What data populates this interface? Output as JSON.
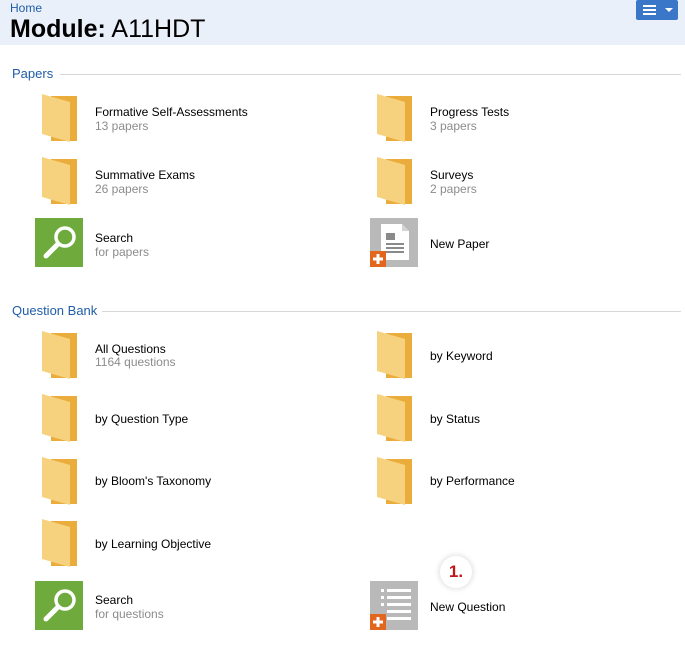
{
  "header": {
    "breadcrumb": "Home",
    "title_prefix": "Module:",
    "title_code": "A11HDT"
  },
  "papers": {
    "title": "Papers",
    "formative": {
      "label": "Formative Self-Assessments",
      "sub": "13 papers"
    },
    "progress": {
      "label": "Progress Tests",
      "sub": "3 papers"
    },
    "summative": {
      "label": "Summative Exams",
      "sub": "26 papers"
    },
    "surveys": {
      "label": "Surveys",
      "sub": "2 papers"
    },
    "search": {
      "label": "Search",
      "sub": "for papers"
    },
    "new_paper": {
      "label": "New Paper"
    }
  },
  "question_bank": {
    "title": "Question Bank",
    "all": {
      "label": "All Questions",
      "sub": "1164 questions"
    },
    "keyword": {
      "label": "by Keyword"
    },
    "type": {
      "label": "by Question Type"
    },
    "status": {
      "label": "by Status"
    },
    "bloom": {
      "label": "by Bloom's Taxonomy"
    },
    "performance": {
      "label": "by Performance"
    },
    "objective": {
      "label": "by Learning Objective"
    },
    "search": {
      "label": "Search",
      "sub": "for questions"
    },
    "new_question": {
      "label": "New Question"
    }
  },
  "annotation": {
    "step": "1."
  },
  "icons": {
    "folder": "folder-icon",
    "search": "magnifier-search-icon",
    "new_paper": "new-paper-document-icon",
    "new_question": "new-question-list-icon",
    "menu": "hamburger-menu-icon"
  },
  "colors": {
    "folder_front": "#f7d27e",
    "folder_back": "#eaad3b",
    "search_tile": "#6eab3c",
    "doc_tile": "#b9b9b9",
    "plus_badge": "#e2661e",
    "link_blue": "#1f5da8",
    "header_bg": "#eaf0f9",
    "menu_button": "#3a77c8",
    "step_red": "#c0161c"
  }
}
